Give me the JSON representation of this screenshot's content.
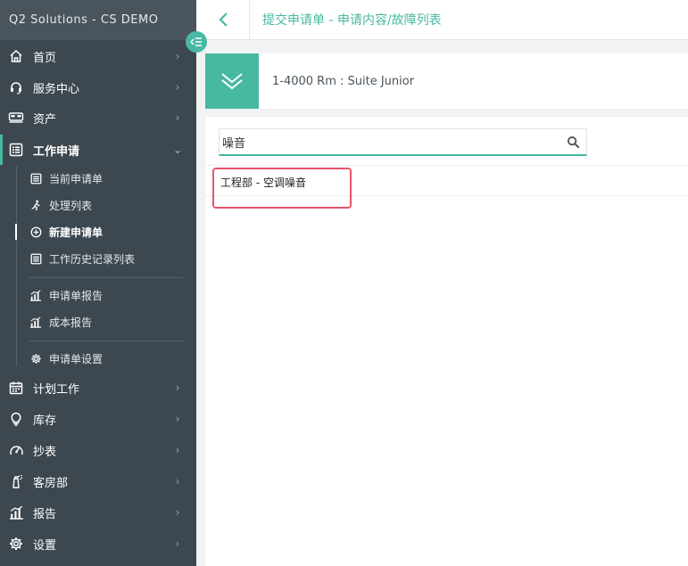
{
  "app": {
    "brand": "Q2 Solutions - CS DEMO"
  },
  "header": {
    "breadcrumb": "提交申请单 - 申请内容/故障列表"
  },
  "asset": {
    "title": "1-4000 Rm : Suite Junior"
  },
  "search": {
    "value": "噪音",
    "placeholder": ""
  },
  "results": [
    {
      "label": "工程部 - 空调噪音"
    }
  ],
  "sidebar": {
    "items": [
      {
        "label": "首页",
        "icon": "home-icon"
      },
      {
        "label": "服务中心",
        "icon": "headset-icon"
      },
      {
        "label": "资产",
        "icon": "bed-icon"
      },
      {
        "label": "工作申请",
        "icon": "list-icon"
      },
      {
        "label": "计划工作",
        "icon": "calendar-icon"
      },
      {
        "label": "库存",
        "icon": "lightbulb-icon"
      },
      {
        "label": "抄表",
        "icon": "gauge-icon"
      },
      {
        "label": "客房部",
        "icon": "spray-icon"
      },
      {
        "label": "报告",
        "icon": "chart-icon"
      },
      {
        "label": "设置",
        "icon": "gear-icon"
      }
    ],
    "sub_items": [
      {
        "label": "当前申请单",
        "icon": "list-icon"
      },
      {
        "label": "处理列表",
        "icon": "runner-icon"
      },
      {
        "label": "新建申请单",
        "icon": "plus-circle-icon"
      },
      {
        "label": "工作历史记录列表",
        "icon": "list-icon"
      },
      {
        "label": "申请单报告",
        "icon": "chart-icon"
      },
      {
        "label": "成本报告",
        "icon": "chart-icon"
      },
      {
        "label": "申请单设置",
        "icon": "gear-icon"
      }
    ]
  },
  "colors": {
    "accent": "#47b8a2",
    "sidebar_bg": "#3d474f",
    "highlight": "#e8536a"
  }
}
